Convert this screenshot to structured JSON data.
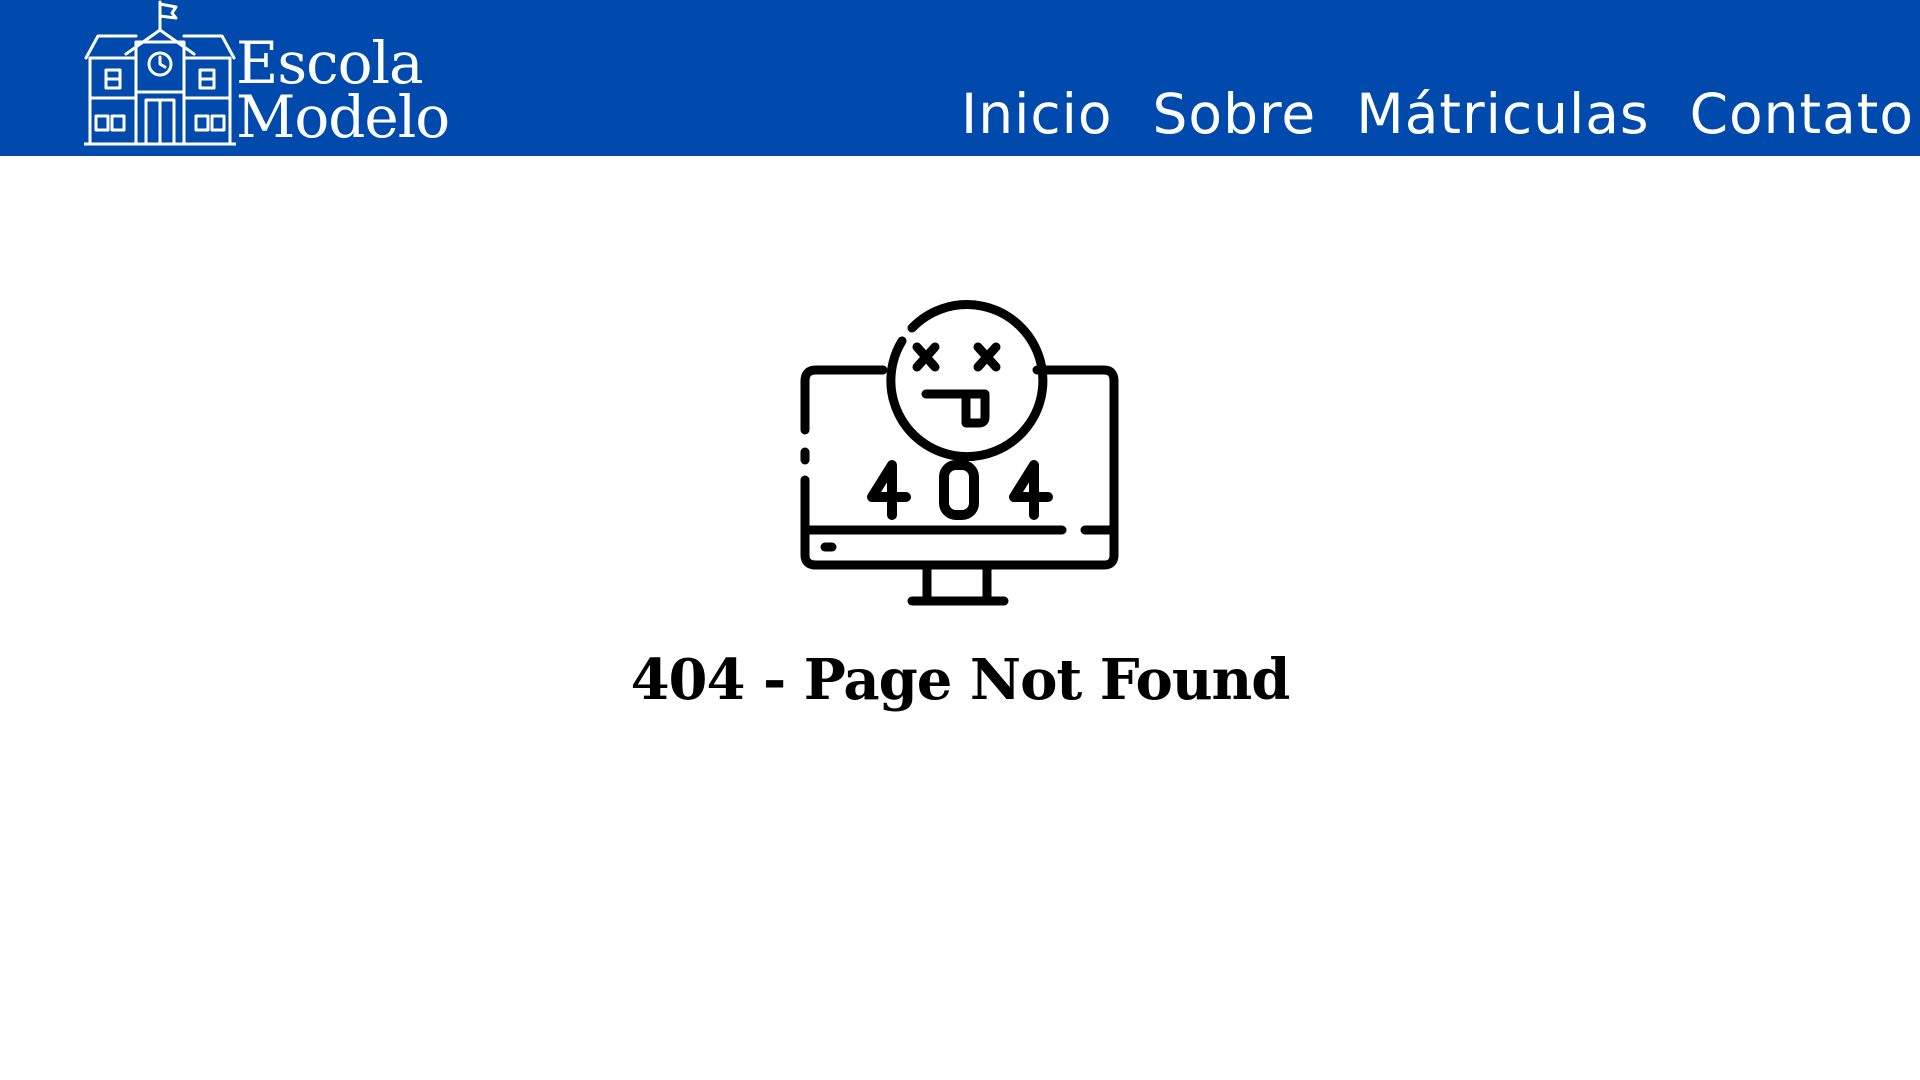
{
  "header": {
    "background_color": "#004aad",
    "logo": {
      "line1": "Escola",
      "line2": "Modelo",
      "icon": "school-building-icon"
    },
    "nav": [
      {
        "label": "Inicio"
      },
      {
        "label": "Sobre"
      },
      {
        "label": "Mátriculas"
      },
      {
        "label": "Contato"
      }
    ]
  },
  "main": {
    "illustration": {
      "icon": "computer-404-icon",
      "screen_text": "404"
    },
    "error_title": "404 - Page Not Found"
  }
}
